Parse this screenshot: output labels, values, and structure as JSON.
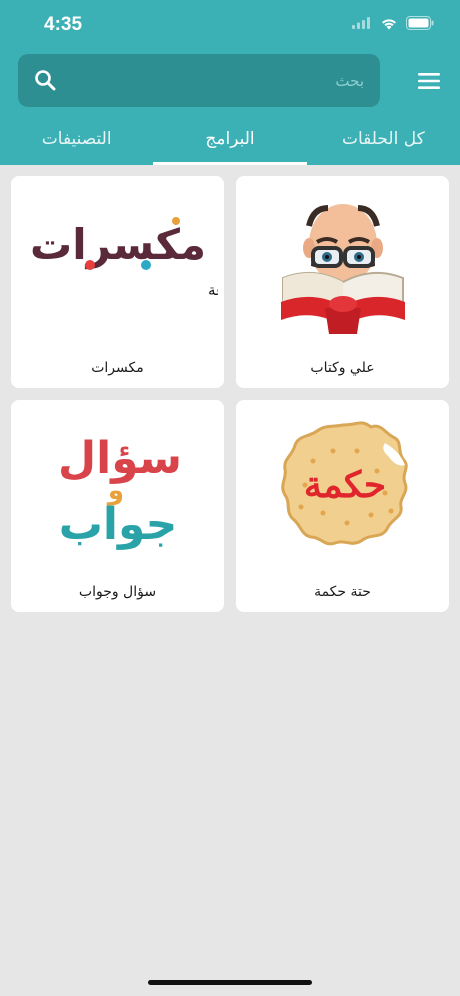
{
  "status_bar": {
    "time": "4:35"
  },
  "search": {
    "placeholder": "بحث",
    "icon": "search-icon"
  },
  "menu": {
    "icon": "hamburger-menu-icon"
  },
  "tabs": [
    {
      "label": "كل الحلقات",
      "active": false
    },
    {
      "label": "البرامج",
      "active": true
    },
    {
      "label": "التصنيفات",
      "active": false
    }
  ],
  "programs": [
    {
      "title": "علي وكتاب",
      "artwork": "man-reading-book-illustration"
    },
    {
      "title": "مكسرات",
      "artwork": "mokasarat-logo",
      "logo_text": "مكسرات",
      "tagline": "لذيذة .. مفيدة .. متنوعة"
    },
    {
      "title": "حتة حكمة",
      "artwork": "biscuit-logo",
      "logo_text": "حكمة"
    },
    {
      "title": "سؤال وجواب",
      "artwork": "question-answer-logo",
      "logo_text_top": "سؤال",
      "logo_text_mid": "و",
      "logo_text_bottom": "جواب"
    }
  ],
  "colors": {
    "header": "#3cb1b5",
    "search_bg": "#2e8f93",
    "background": "#e6e6e6",
    "card": "#ffffff"
  }
}
